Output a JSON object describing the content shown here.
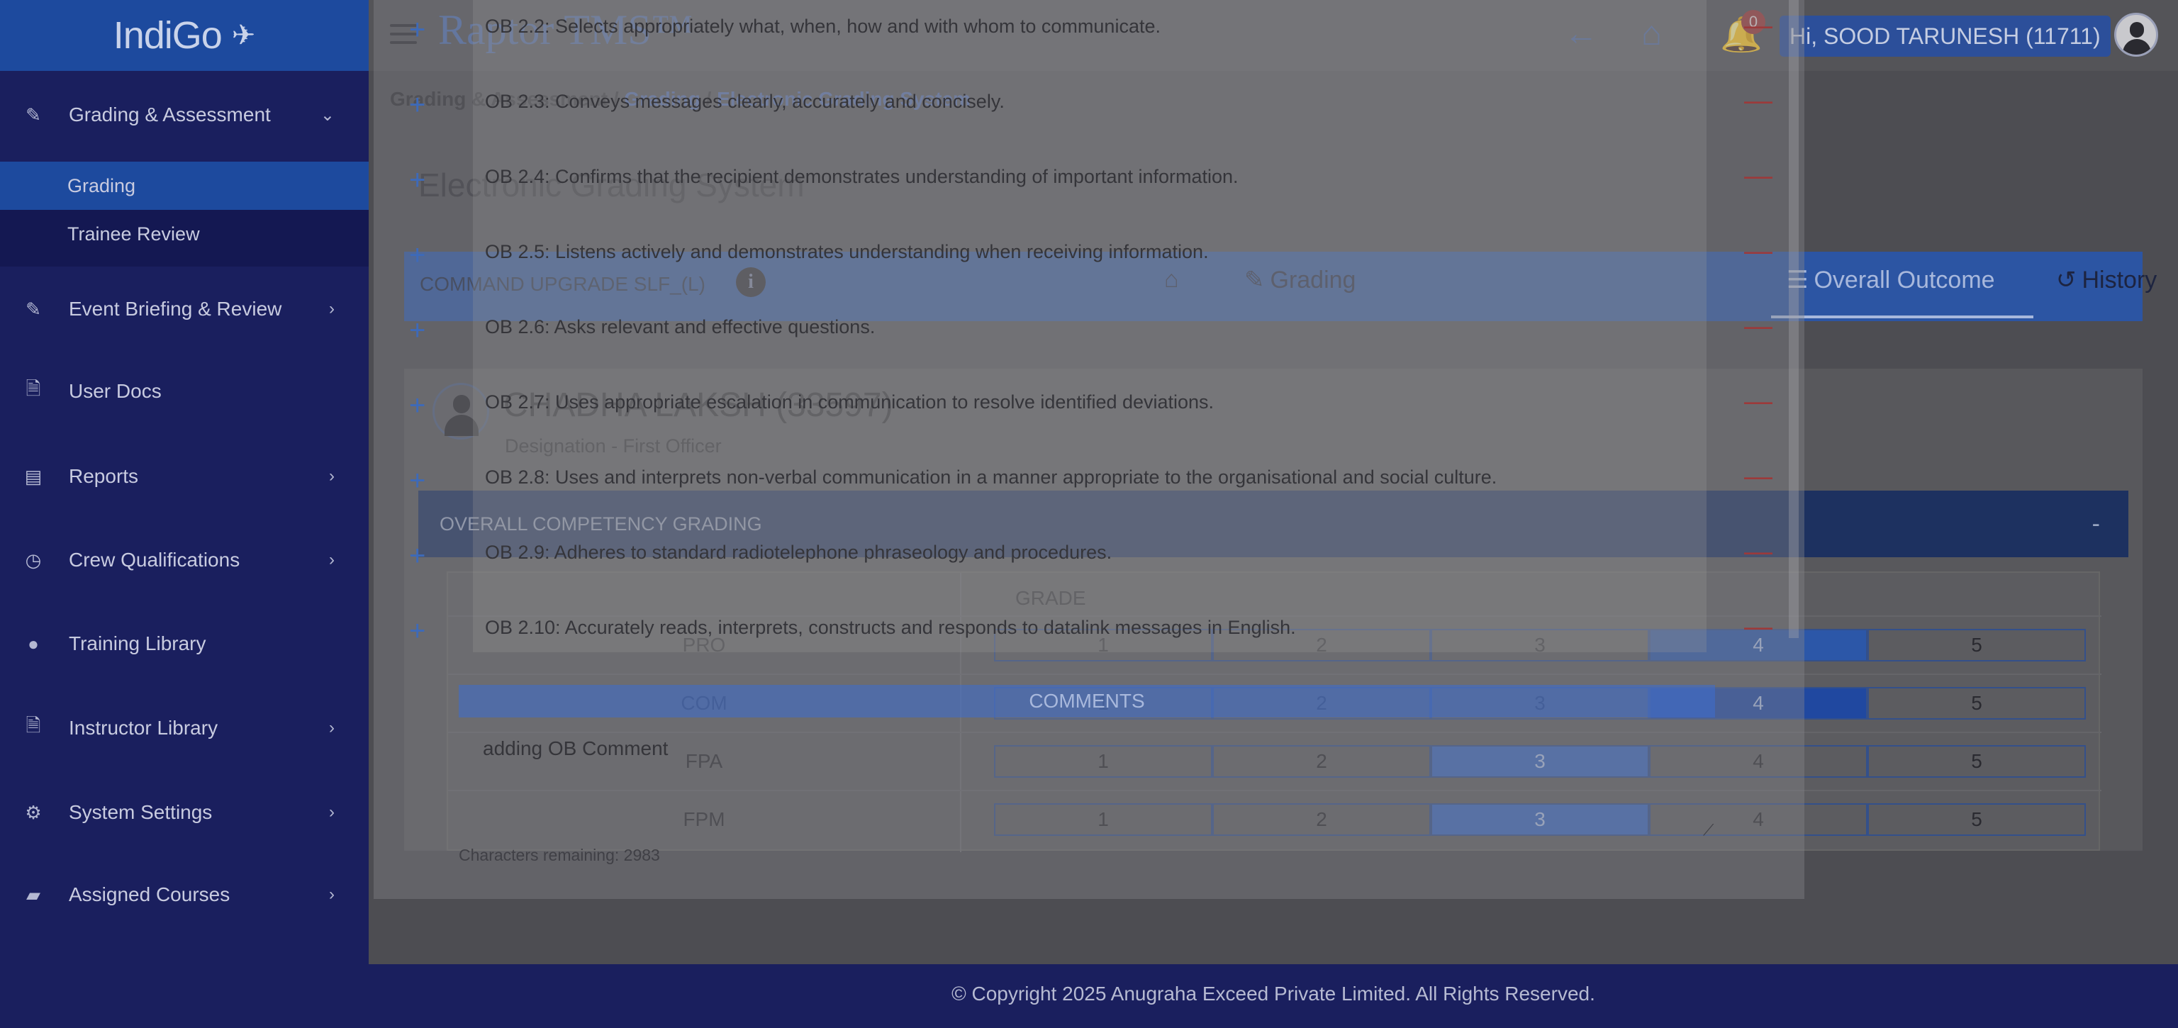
{
  "sidebar": {
    "logo": "IndiGo",
    "items": [
      {
        "label": "Grading & Assessment",
        "icon": "edit-icon",
        "chevron": "⌄"
      },
      {
        "label": "Event Briefing & Review",
        "icon": "edit-icon",
        "chevron": "›"
      },
      {
        "label": "User Docs",
        "icon": "document-icon",
        "chevron": ""
      },
      {
        "label": "Reports",
        "icon": "report-icon",
        "chevron": "›"
      },
      {
        "label": "Crew Qualifications",
        "icon": "clock-icon",
        "chevron": "›"
      },
      {
        "label": "Training Library",
        "icon": "user-icon",
        "chevron": ""
      },
      {
        "label": "Instructor Library",
        "icon": "document-icon",
        "chevron": "›"
      },
      {
        "label": "System Settings",
        "icon": "cogs-icon",
        "chevron": "›"
      },
      {
        "label": "Assigned Courses",
        "icon": "folder-open-icon",
        "chevron": "›"
      }
    ],
    "sub_items": [
      {
        "label": "Grading",
        "active": true
      },
      {
        "label": "Trainee Review",
        "active": false
      }
    ]
  },
  "topbar": {
    "brand": "Raptor TMS™",
    "notification_count": "0",
    "user": "Hi, SOOD TARUNESH (11711)"
  },
  "breadcrumb": {
    "root": "Grading & Assessment",
    "sep": "/",
    "level1": "Grading",
    "level2": "Electronic Grading System"
  },
  "page_title": "Electronic Grading System",
  "command_bar": {
    "label": "COMMAND UPGRADE SLF_(L)",
    "tabs": [
      {
        "label": "",
        "icon": "home-icon"
      },
      {
        "label": "Grading",
        "icon": "edit-icon"
      },
      {
        "label": "Overall Outcome",
        "icon": "list-icon",
        "active": true
      },
      {
        "label": "History",
        "icon": "history-icon"
      }
    ]
  },
  "trainee": {
    "name": "CHADHA LAKSH (33597)",
    "designation": "Designation - First Officer"
  },
  "overall": {
    "title": "OVERALL COMPETENCY GRADING",
    "toggle": "-",
    "grade_header": "GRADE",
    "grades": [
      "1",
      "2",
      "3",
      "4",
      "5"
    ],
    "rows": [
      {
        "competency": "PRO",
        "selected": "4"
      },
      {
        "competency": "COM",
        "selected": "4"
      },
      {
        "competency": "FPA",
        "selected": "3"
      },
      {
        "competency": "FPM",
        "selected": "3"
      }
    ]
  },
  "modal": {
    "obs": [
      "OB 2.2: Selects appropriately what, when, how and with whom to communicate.",
      "OB 2.3: Conveys messages clearly, accurately and concisely.",
      "OB 2.4: Confirms that the recipient demonstrates understanding of important information.",
      "OB 2.5: Listens actively and demonstrates understanding when receiving information.",
      "OB 2.6: Asks relevant and effective questions.",
      "OB 2.7: Uses appropriate escalation in communication to resolve identified deviations.",
      "OB 2.8: Uses and interprets non-verbal communication in a manner appropriate to the organisational and social culture.",
      "OB 2.9: Adheres to standard radiotelephone phraseology and procedures.",
      "OB 2.10: Accurately reads, interprets, constructs and responds to datalink messages in English."
    ],
    "plus_icon": "+",
    "minus_icon": "—",
    "comments_label": "COMMENTS",
    "comment_value": "adding OB Comment",
    "chars_remaining": "Characters remaining: 2983"
  },
  "footer": "© Copyright 2025 Anugraha Exceed Private Limited.  All Rights Reserved."
}
